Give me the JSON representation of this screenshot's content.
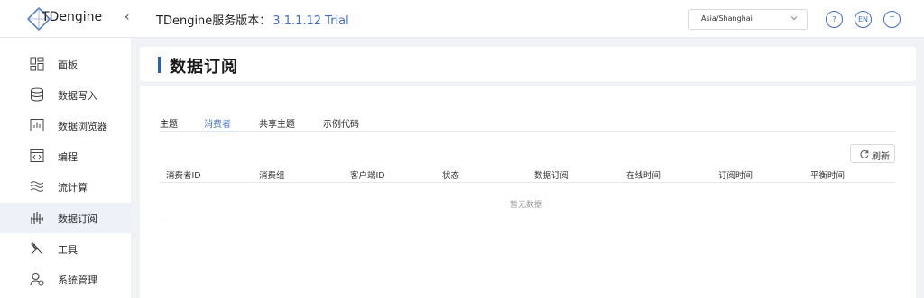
{
  "app": {
    "logo_text": "TDengine",
    "collapse_icon": "chevron-left-icon"
  },
  "header": {
    "version_label": "TDengine服务版本：",
    "version_value": "3.1.1.12 Trial",
    "timezone": "Asia/Shanghai",
    "help_label": "?",
    "lang_label": "EN",
    "user_initial": "T",
    "accent": "#3f6fc4"
  },
  "sidebar": {
    "items": [
      {
        "label": "面板",
        "icon": "dashboard-icon"
      },
      {
        "label": "数据写入",
        "icon": "database-write-icon"
      },
      {
        "label": "数据浏览器",
        "icon": "data-browser-icon"
      },
      {
        "label": "编程",
        "icon": "code-icon"
      },
      {
        "label": "流计算",
        "icon": "stream-icon"
      },
      {
        "label": "数据订阅",
        "icon": "subscribe-icon",
        "active": true
      },
      {
        "label": "工具",
        "icon": "tools-icon"
      },
      {
        "label": "系统管理",
        "icon": "user-admin-icon"
      }
    ]
  },
  "page": {
    "title": "数据订阅",
    "tabs": [
      {
        "label": "主题"
      },
      {
        "label": "消费者",
        "active": true
      },
      {
        "label": "共享主题"
      },
      {
        "label": "示例代码"
      }
    ],
    "refresh_label": "刷新",
    "columns": [
      "消费者ID",
      "消费组",
      "客户端ID",
      "状态",
      "数据订阅",
      "在线时间",
      "订阅时间",
      "平衡时间"
    ],
    "empty_text": "暂无数据"
  }
}
